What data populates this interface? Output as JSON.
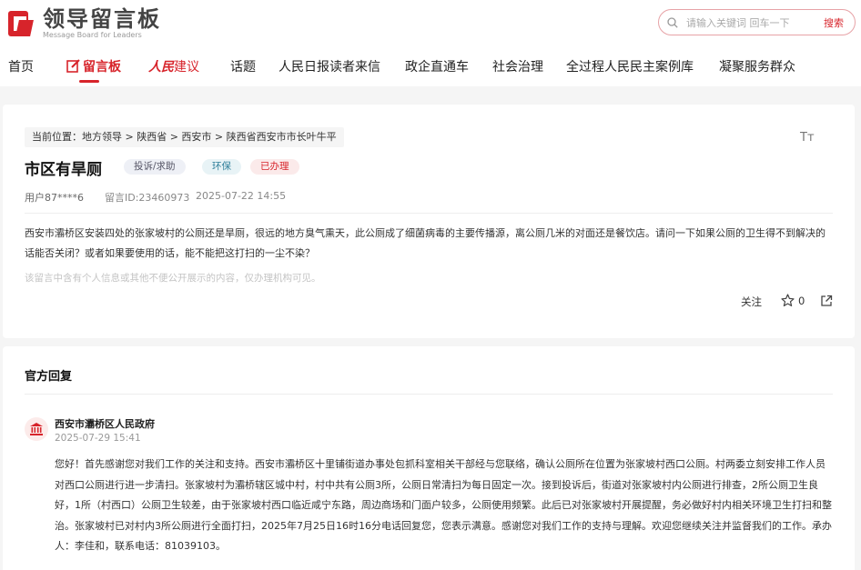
{
  "header": {
    "logo_cn": "领导留言板",
    "logo_en": "Message Board for Leaders",
    "search_placeholder": "请输入关键词 回车一下",
    "search_button": "搜索"
  },
  "nav": {
    "home": "首页",
    "message_board": "留言板",
    "renmin_brand": "人民",
    "renmin_suffix": "建议",
    "topics": "话题",
    "reader_letters": "人民日报读者来信",
    "gov_business": "政企直通车",
    "social_governance": "社会治理",
    "democracy_cases": "全过程人民民主案例库",
    "serve_people": "凝聚服务群众"
  },
  "message": {
    "breadcrumb": "当前位置：地方领导 > 陕西省 > 西安市 > 陕西省西安市市长叶牛平",
    "title": "市区有旱厕",
    "tags": [
      "投诉/求助",
      "环保",
      "已办理"
    ],
    "user": "用户87****6",
    "id_label": "留言ID:23460973",
    "time": "2025-07-22 14:55",
    "content": "西安市灞桥区安装四处的张家坡村的公厕还是旱厕，很远的地方臭气熏天，此公厕成了细菌病毒的主要传播源，离公厕几米的对面还是餐饮店。请问一下如果公厕的卫生得不到解决的话能否关闭？或者如果要使用的话，能不能把这打扫的一尘不染？",
    "note": "该留言中含有个人信息或其他不便公开展示的内容，仅办理机构可见。",
    "follow_label": "关注",
    "star_count": "0",
    "font_toggle": "Tт"
  },
  "reply": {
    "section_title": "官方回复",
    "org_name": "西安市灞桥区人民政府",
    "time": "2025-07-29 15:41",
    "content": "您好！首先感谢您对我们工作的关注和支持。西安市灞桥区十里铺街道办事处包抓科室相关干部经与您联络，确认公厕所在位置为张家坡村西口公厕。村两委立刻安排工作人员对西口公厕进行进一步清扫。张家坡村为灞桥辖区城中村，村中共有公厕3所，公厕日常清扫为每日固定一次。接到投诉后，街道对张家坡村内公厕进行排查，2所公厕卫生良好，1所（村西口）公厕卫生较差，由于张家坡村西口临近咸宁东路，周边商场和门面户较多，公厕使用频繁。此后已对张家坡村开展提醒，务必做好村内相关环境卫生打扫和整治。张家坡村已对村内3所公厕进行全面打扫，2025年7月25日16时16分电话回复您，您表示满意。感谢您对我们工作的支持与理解。欢迎您继续关注并监督我们的工作。承办人：李佳和，联系电话：81039103。"
  },
  "colors": {
    "accent": "#d7242b",
    "background": "#f5f5f5"
  }
}
